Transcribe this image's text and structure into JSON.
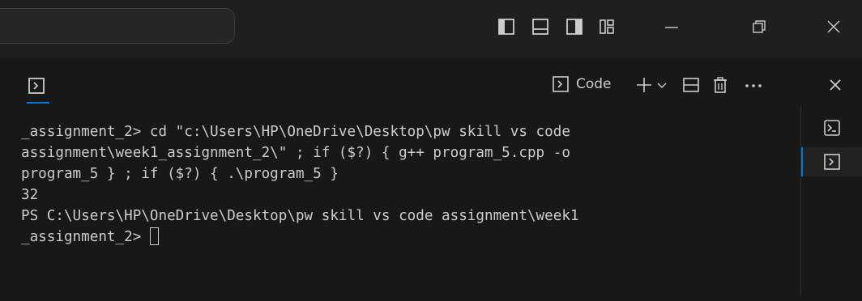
{
  "window": {
    "icons": [
      "toggle-primary-sidebar-icon",
      "toggle-panel-icon",
      "toggle-secondary-sidebar-icon",
      "customize-layout-icon",
      "minimize-icon",
      "restore-icon",
      "close-icon"
    ]
  },
  "panel": {
    "tab_icon": "terminal-icon",
    "terminal_name": "Code",
    "actions": [
      "new-terminal-icon",
      "terminal-dropdown-icon",
      "split-terminal-icon",
      "kill-terminal-icon",
      "more-actions-icon",
      "close-panel-icon"
    ]
  },
  "terminal": {
    "lines": [
      "_assignment_2> cd \"c:\\Users\\HP\\OneDrive\\Desktop\\pw skill vs code",
      "assignment\\week1_assignment_2\\\" ; if ($?) { g++ program_5.cpp -o",
      "program_5 } ; if ($?) { .\\program_5 }",
      "32",
      "PS C:\\Users\\HP\\OneDrive\\Desktop\\pw skill vs code assignment\\week1",
      "_assignment_2> "
    ]
  },
  "colors": {
    "background": "#181818",
    "titlebar": "#1f1f1f",
    "accent": "#0078d4",
    "text": "#cccccc"
  }
}
